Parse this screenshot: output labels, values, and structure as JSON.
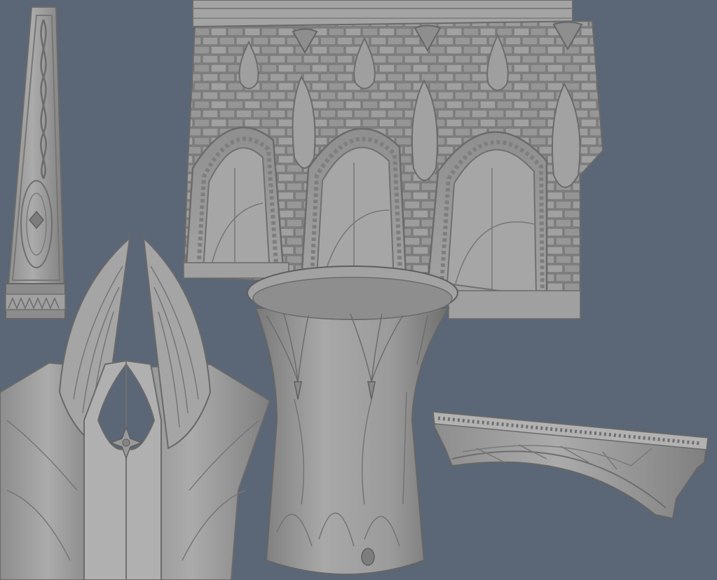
{
  "scene": {
    "background_color": "#5b6676",
    "stone_color": "#9a9a9a",
    "stone_light": "#b4b4b4",
    "stone_dark": "#6e6e6e",
    "objects": [
      {
        "name": "carved-pilaster",
        "description_icon": "tall-tapered-panel"
      },
      {
        "name": "arched-wall-section",
        "description_icon": "gothic-arches-wall"
      },
      {
        "name": "winged-gate",
        "description_icon": "winged-door-with-star"
      },
      {
        "name": "flared-column",
        "description_icon": "column-capital"
      },
      {
        "name": "arched-bridge-beam",
        "description_icon": "small-arch-beam"
      }
    ]
  }
}
